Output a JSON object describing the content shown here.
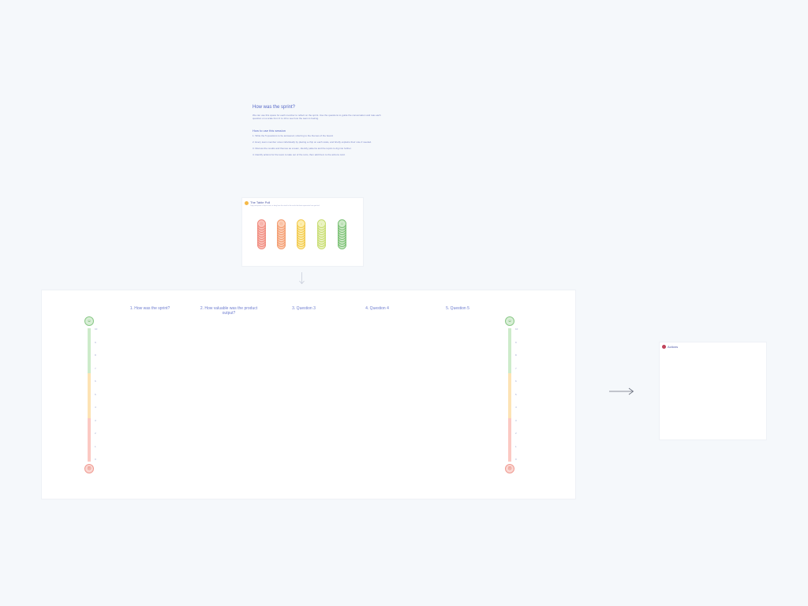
{
  "colors": {
    "canvas_bg": "#f5f8fb",
    "card_bg": "#ffffff",
    "text_accent": "#5668c7",
    "scale_green": "#cdebca",
    "scale_yellow": "#fde3b4",
    "scale_red": "#fbc9c3"
  },
  "intro": {
    "title": "How was the sprint?",
    "description": "We can use this space for each member to reflect on the sprint. Use the questions to guide the conversation and rate each question on a scale from 0 to 10 to see how the team is feeling.",
    "howto_title": "How to use this session",
    "steps": [
      "1. Write the 5 questions to be answered, referring to the themes of the board.",
      "2. Every team member votes individually by placing a chip on each scale, and briefly explains their vote if needed.",
      "3. Discuss the results and themes as a team, identify patterns and the topics to dig into further.",
      "4. Identify actions for the team to take out of the retro, then add them to the actions card."
    ]
  },
  "poll": {
    "title": "The Table Poll",
    "description": "Copy and paste a chip to vote, or drag from the stack to the scale that best represents how you feel."
  },
  "questions": [
    "1. How was the sprint?",
    "2. How valuable was the product output?",
    "3. Question 3",
    "4. Question 4",
    "5. Question 5"
  ],
  "scale": {
    "ticks": [
      "10",
      "9",
      "8",
      "7",
      "6",
      "5",
      "4",
      "3",
      "2",
      "1",
      "0"
    ],
    "face_top": "☺",
    "face_bottom": "☹"
  },
  "actions": {
    "label": "Actions"
  },
  "icons": {
    "poll_badge": "smiley-icon",
    "actions_icon": "action-icon",
    "down_arrow": "arrow-down-icon",
    "right_arrow": "arrow-right-icon"
  }
}
